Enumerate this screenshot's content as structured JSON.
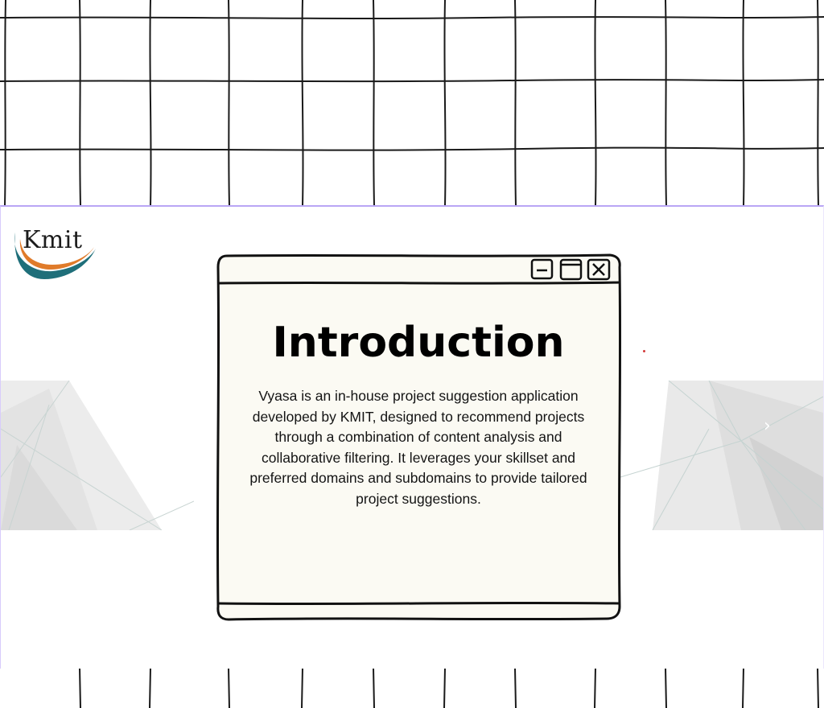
{
  "logo": {
    "text": "Kmit"
  },
  "window": {
    "title": "Introduction",
    "body": "Vyasa is an in-house project suggestion application developed by KMIT, designed to recommend projects through a combination of content analysis and collaborative filtering. It leverages your skillset and preferred domains and subdomains to provide tailored project suggestions.",
    "controls": [
      "minimize-icon",
      "maximize-icon",
      "close-icon"
    ]
  },
  "carousel": {
    "next_icon": "chevron-right-icon",
    "next_glyph": "›"
  },
  "colors": {
    "logo_orange": "#e07b2a",
    "logo_teal": "#1f6f7a",
    "window_fill": "#fbfaf3",
    "slide_border": "#b9a6f5"
  }
}
